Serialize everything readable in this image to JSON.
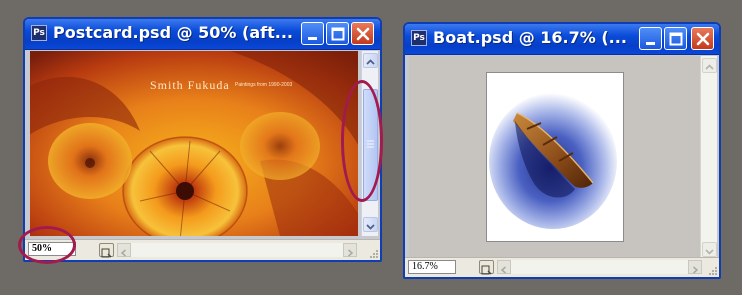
{
  "windows": [
    {
      "title": "Postcard.psd @ 50% (aft...",
      "zoom": "50%",
      "canvas": {
        "heading": "Smith Fukuda",
        "subheading": "Paintings from 1990-2003"
      }
    },
    {
      "title": "Boat.psd @ 16.7% (...",
      "zoom": "16.7%"
    }
  ],
  "title_buttons": [
    "minimize-icon",
    "maximize-icon",
    "close-icon"
  ],
  "colors": {
    "title_bar": "#0a4bd8",
    "window_border": "#0f3db2",
    "close_button": "#c4391c",
    "highlight_circle": "#a31b4e",
    "postcard_orange": "#e8801a",
    "desktop": "#6e6a65"
  }
}
